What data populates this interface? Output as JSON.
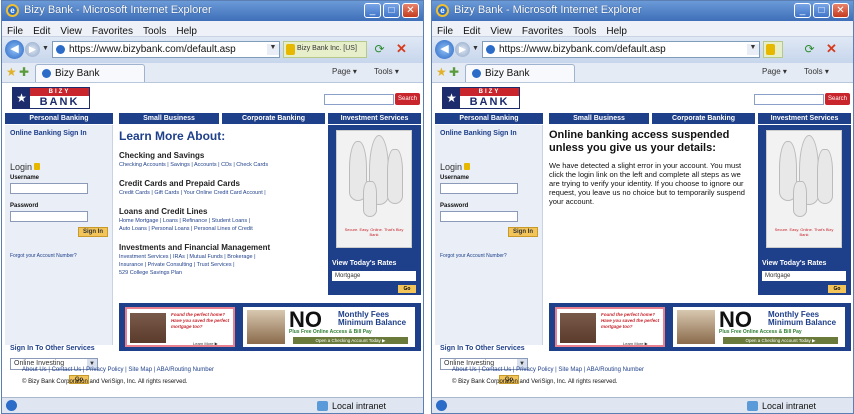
{
  "windows": [
    {
      "title": "Bizy Bank - Microsoft Internet Explorer",
      "menu": [
        "File",
        "Edit",
        "View",
        "Favorites",
        "Tools",
        "Help"
      ],
      "address": "https://www.bizybank.com/default.asp",
      "security_badge": "Bizy Bank Inc. [US]",
      "tab_label": "Bizy Bank",
      "commands": [
        "Page ▾",
        "Tools ▾"
      ],
      "status_zone": "Local intranet",
      "mode": "normal"
    },
    {
      "title": "Bizy Bank - Microsoft Internet Explorer",
      "menu": [
        "File",
        "Edit",
        "View",
        "Favorites",
        "Tools",
        "Help"
      ],
      "address": "https://www.bizybank.com/default.asp",
      "security_badge": "",
      "tab_label": "Bizy Bank",
      "commands": [
        "Page ▾",
        "Tools ▾"
      ],
      "status_zone": "Local intranet",
      "mode": "alert"
    }
  ],
  "site": {
    "logo_top": "BIZY",
    "logo_bottom": "BANK",
    "search_button": "Search",
    "nav": [
      "Personal Banking",
      "Small Business",
      "Corporate Banking",
      "Investment Services"
    ],
    "sign_in_heading": "Online Banking Sign In",
    "login_label": "Login",
    "username_label": "Username",
    "password_label": "Password",
    "signin_button": "Sign In",
    "forgot_link": "Forgot your Account Number?",
    "other_services_heading": "Sign In To Other Services",
    "other_services_select": "Online Investing",
    "go_button": "Go",
    "learn_title": "Learn More About:",
    "sections": [
      {
        "title": "Checking and Savings",
        "links": "Checking Accounts | Savings | Accounts | CDs | Check Cards"
      },
      {
        "title": "Credit Cards and Prepaid Cards",
        "links": "Credit Cards | Gift Cards | Your Online Credit Card Account |"
      },
      {
        "title": "Loans and Credit Lines",
        "links": "Home Mortgage | Loans | Refinance | Student Loans |\nAuto Loans | Personal Loans | Personal Lines of Credit"
      },
      {
        "title": "Investments and Financial Management",
        "links": "Investment Services | IRAs | Mutual Funds | Brokerage |\nInsurance | Private Consulting | Trust Services |\n529 College Savings Plan"
      }
    ],
    "family_caption": "Secure. Easy. Online. That's Bizy Bank",
    "rates_heading": "View Today's Rates",
    "rates_select": "Mortgage",
    "alert_title": "Online banking access suspended unless you give us your details:",
    "alert_body": "We have detected a slight error in your account. You must click the login link on the left and complete all steps as we are trying to verify your identity.  If you choose to ignore our request, you leave us no choice but to temporarily suspend your account.",
    "ad1_text": "Found the perfect home? Have you saved the perfect mortgage too?",
    "ad1_learn": "Learn More ▶",
    "ad2_no": "NO",
    "ad2_fees": "Monthly Fees\nMinimum Balance",
    "ad2_sub": "Plus Free Online Access & Bill Pay",
    "ad2_cta": "Open a Checking Account Today ▶",
    "footer_links": "About Us | Contact Us | Privacy Policy | Site Map | ABA/Routing Number",
    "footer_copy": "© Bizy Bank Corporation and VeriSign, Inc. All rights reserved."
  }
}
